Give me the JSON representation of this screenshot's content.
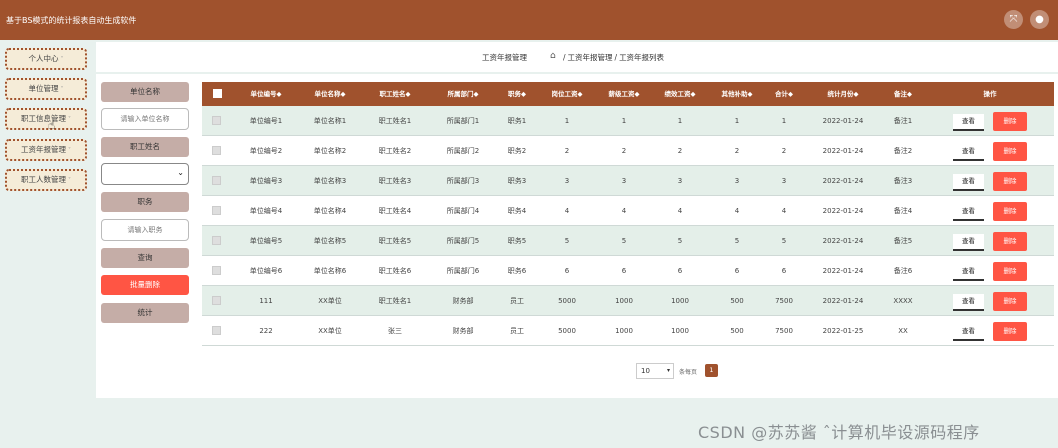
{
  "app": {
    "title": "基于BS模式的统计报表自动生成软件",
    "fullscreen_icon": "⤧",
    "user_icon": "●"
  },
  "sidebar": {
    "items": [
      {
        "label": "个人中心"
      },
      {
        "label": "单位管理"
      },
      {
        "label": "职工信息管理"
      },
      {
        "label": "工资年报管理"
      },
      {
        "label": "职工人数管理"
      }
    ],
    "caret": "˅"
  },
  "breadcrumb": {
    "title": "工资年报管理",
    "home_icon": "⌂",
    "sep": "/",
    "level1": "工资年报管理",
    "level2": "工资年报列表"
  },
  "filters": {
    "unit_name_label": "单位名称",
    "unit_name_placeholder": "请输入单位名称",
    "staff_name_label": "职工姓名",
    "staff_name_value": "",
    "position_label": "职务",
    "position_placeholder": "请输入职务",
    "query_button": "查询",
    "batch_delete_button": "批量删除",
    "stats_button": "统计"
  },
  "colors": {
    "brand": "#a0522d",
    "danger": "#ff5544",
    "row_alt": "#e4efe9",
    "filter_label": "#c5ada7"
  },
  "table": {
    "columns": [
      "单位编号◆",
      "单位名称◆",
      "职工姓名◆",
      "所属部门◆",
      "职务◆",
      "岗位工资◆",
      "薪级工资◆",
      "绩效工资◆",
      "其他补助◆",
      "合计◆",
      "统计月份◆",
      "备注◆",
      "操作"
    ],
    "view_label": "查看",
    "delete_label": "删除",
    "rows": [
      [
        "单位编号1",
        "单位名称1",
        "职工姓名1",
        "所属部门1",
        "职务1",
        "1",
        "1",
        "1",
        "1",
        "1",
        "2022-01-24",
        "备注1"
      ],
      [
        "单位编号2",
        "单位名称2",
        "职工姓名2",
        "所属部门2",
        "职务2",
        "2",
        "2",
        "2",
        "2",
        "2",
        "2022-01-24",
        "备注2"
      ],
      [
        "单位编号3",
        "单位名称3",
        "职工姓名3",
        "所属部门3",
        "职务3",
        "3",
        "3",
        "3",
        "3",
        "3",
        "2022-01-24",
        "备注3"
      ],
      [
        "单位编号4",
        "单位名称4",
        "职工姓名4",
        "所属部门4",
        "职务4",
        "4",
        "4",
        "4",
        "4",
        "4",
        "2022-01-24",
        "备注4"
      ],
      [
        "单位编号5",
        "单位名称5",
        "职工姓名5",
        "所属部门5",
        "职务5",
        "5",
        "5",
        "5",
        "5",
        "5",
        "2022-01-24",
        "备注5"
      ],
      [
        "单位编号6",
        "单位名称6",
        "职工姓名6",
        "所属部门6",
        "职务6",
        "6",
        "6",
        "6",
        "6",
        "6",
        "2022-01-24",
        "备注6"
      ],
      [
        "111",
        "XX单位",
        "职工姓名1",
        "财务部",
        "员工",
        "5000",
        "1000",
        "1000",
        "500",
        "7500",
        "2022-01-24",
        "XXXX"
      ],
      [
        "222",
        "XX单位",
        "张三",
        "财务部",
        "员工",
        "5000",
        "1000",
        "1000",
        "500",
        "7500",
        "2022-01-25",
        "XX"
      ]
    ]
  },
  "pagination": {
    "page_size": "10",
    "page_size_label": "条每页",
    "current_page": "1"
  },
  "watermark": "CSDN @苏苏酱  ˆ计算机毕设源码程序"
}
